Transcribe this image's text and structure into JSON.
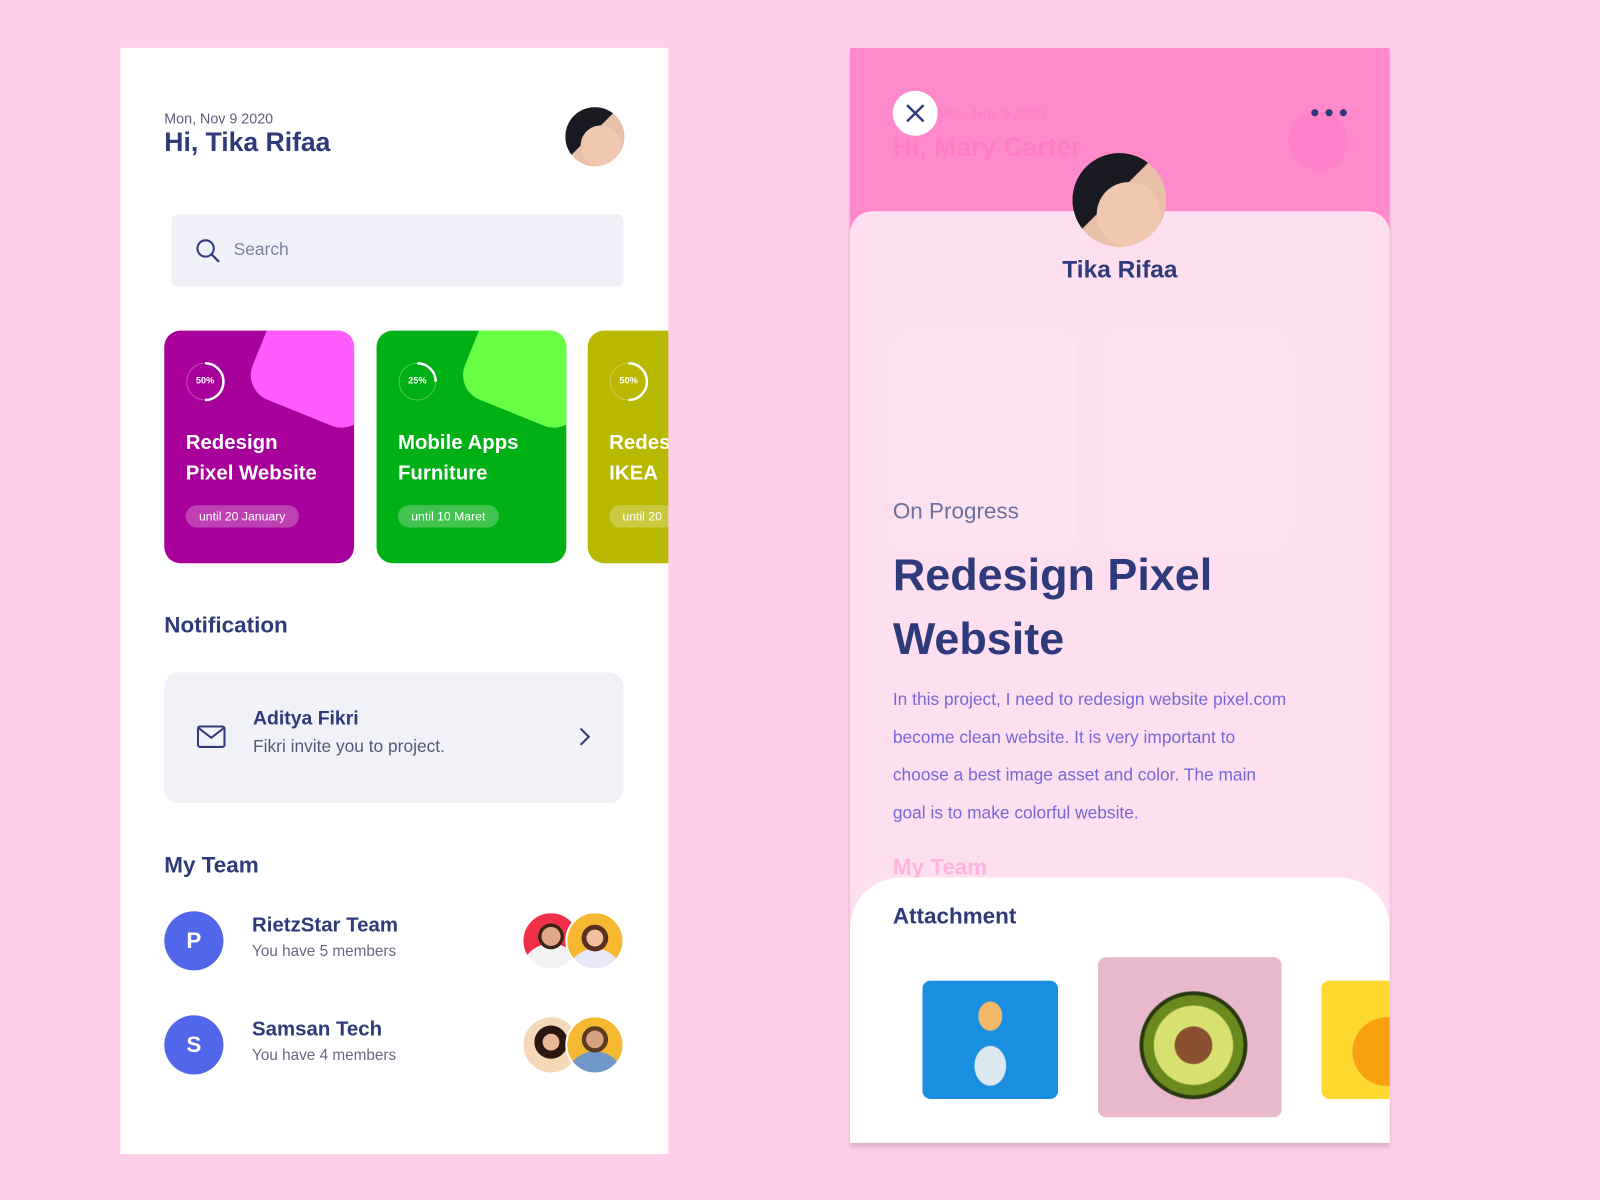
{
  "home": {
    "date": "Mon, Nov 9 2020",
    "greeting": "Hi, Tika Rifaa",
    "search": {
      "placeholder": "Search"
    },
    "projects": [
      {
        "progress": "50%",
        "progress_value": 50,
        "title_line1": "Redesign",
        "title_line2": "Pixel Website",
        "due": "until 20 January",
        "color": "#a8009a",
        "accent": "#ff5cff"
      },
      {
        "progress": "25%",
        "progress_value": 25,
        "title_line1": "Mobile Apps",
        "title_line2": "Furniture",
        "due": "until 10 Maret",
        "color": "#00b015",
        "accent": "#66ff44"
      },
      {
        "progress": "50%",
        "progress_value": 50,
        "title_line1": "Redesign",
        "title_line2": "IKEA",
        "due": "until 20",
        "color": "#b8b800",
        "accent": "#d8d820"
      }
    ],
    "notification": {
      "heading": "Notification",
      "name": "Aditya Fikri",
      "message": "Fikri invite you to project.",
      "icon": "mail-icon"
    },
    "team": {
      "heading": "My Team",
      "items": [
        {
          "initial": "P",
          "name": "RietzStar Team",
          "members": "You have 5 members"
        },
        {
          "initial": "S",
          "name": "Samsan Tech",
          "members": "You have 4 members"
        }
      ]
    }
  },
  "detail": {
    "ghost_date": "Mon, Nov 9 2020",
    "ghost_greeting": "Hi, Mary Carter",
    "ghost_team": "My Team",
    "user_name": "Tika Rifaa",
    "status": "On Progress",
    "title_line1": "Redesign Pixel",
    "title_line2": "Website",
    "description_lines": [
      "In this project, I need to redesign website pixel.com",
      "become clean website. It is very important to",
      "choose a best image asset and color. The main",
      "goal is to make colorful website."
    ],
    "attachment_heading": "Attachment",
    "header_color": "#ff8acb"
  }
}
